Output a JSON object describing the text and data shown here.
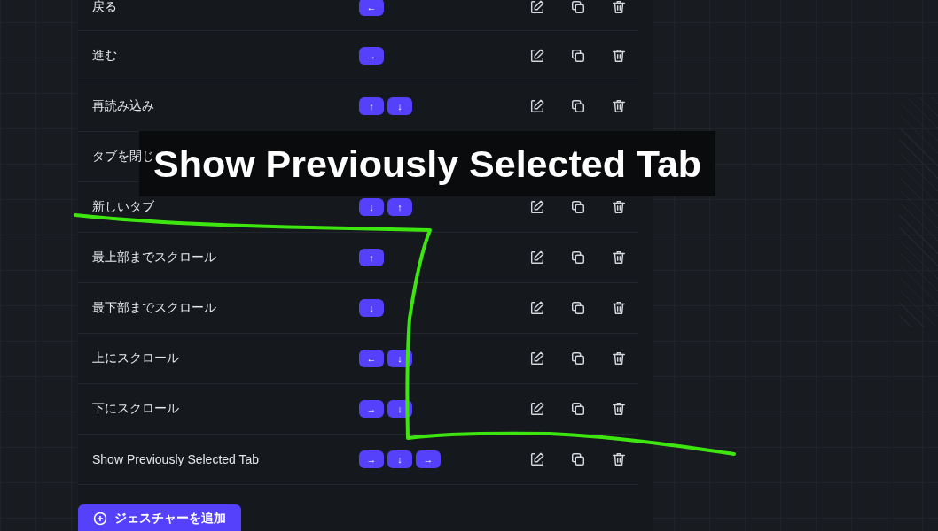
{
  "gestures": [
    {
      "name": "戻る",
      "keys": [
        "←"
      ]
    },
    {
      "name": "進む",
      "keys": [
        "→"
      ]
    },
    {
      "name": "再読み込み",
      "keys": [
        "↑",
        "↓"
      ]
    },
    {
      "name": "タブを閉じ"
    },
    {
      "name": "新しいタブ",
      "keys": [
        "↓",
        "↑"
      ]
    },
    {
      "name": "最上部までスクロール",
      "keys": [
        "↑"
      ]
    },
    {
      "name": "最下部までスクロール",
      "keys": [
        "↓"
      ]
    },
    {
      "name": "上にスクロール",
      "keys": [
        "←",
        "↓"
      ]
    },
    {
      "name": "下にスクロール",
      "keys": [
        "→",
        "↓"
      ]
    },
    {
      "name": "Show Previously Selected Tab",
      "keys": [
        "→",
        "↓",
        "→"
      ]
    }
  ],
  "caption": "Show Previously Selected Tab",
  "add_button": "ジェスチャーを追加"
}
